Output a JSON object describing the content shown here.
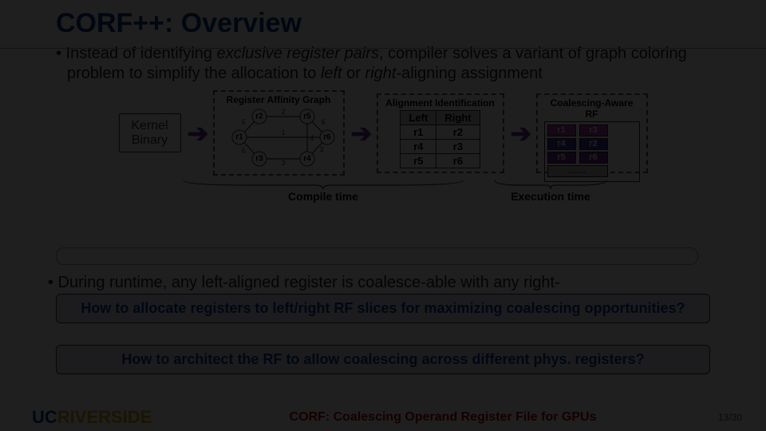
{
  "title": "CORF++: Overview",
  "bullet1_pre": "• Instead of identifying ",
  "bullet1_em1": "exclusive register pairs",
  "bullet1_mid": ", compiler solves a variant of graph coloring problem to simplify the allocation to ",
  "bullet1_em2": "left",
  "bullet1_or": " or ",
  "bullet1_em3": "right",
  "bullet1_post": "-aligning assignment",
  "kernel_line1": "Kernel",
  "kernel_line2": "Binary",
  "panel_graph_title": "Register Affinity Graph",
  "panel_align_title": "Alignment Identification",
  "panel_rf_title": "Coalescing-Aware RF",
  "graph": {
    "nodes": [
      "r1",
      "r2",
      "r3",
      "r4",
      "r5",
      "r6"
    ],
    "edges": [
      {
        "a": "r1",
        "b": "r2",
        "w": "5"
      },
      {
        "a": "r2",
        "b": "r5",
        "w": "2"
      },
      {
        "a": "r5",
        "b": "r6",
        "w": "6"
      },
      {
        "a": "r1",
        "b": "r6",
        "w": "1"
      },
      {
        "a": "r1",
        "b": "r3",
        "w": "6"
      },
      {
        "a": "r3",
        "b": "r4",
        "w": "3"
      },
      {
        "a": "r4",
        "b": "r5",
        "w": "4"
      },
      {
        "a": "r4",
        "b": "r6",
        "w": "3"
      }
    ]
  },
  "align_headers": {
    "left": "Left",
    "right": "Right"
  },
  "align_rows": [
    {
      "l": "r1",
      "r": "r2"
    },
    {
      "l": "r4",
      "r": "r3"
    },
    {
      "l": "r5",
      "r": "r6"
    }
  ],
  "rf_rows": [
    {
      "l": "r1",
      "r": "r3",
      "lc": "c13",
      "rc": "c13"
    },
    {
      "l": "r4",
      "r": "r2",
      "lc": "c42",
      "rc": "c42"
    },
    {
      "l": "r5",
      "r": "r6",
      "lc": "c56",
      "rc": "c56"
    }
  ],
  "rf_more": "……",
  "stage_compile": "Compile time",
  "stage_exec": "Execution time",
  "bullet2": "• During runtime, any left-aligned register is coalesce-able with any right-",
  "question1": "How to allocate registers to left/right RF slices for maximizing coalescing opportunities?",
  "question2": "How to architect the RF to allow coalescing across different phys. registers?",
  "logo_uc": "UC",
  "logo_rv": "RIVERSIDE",
  "footer_title": "CORF: Coalescing Operand Register File for GPUs",
  "page_num": "13/30"
}
